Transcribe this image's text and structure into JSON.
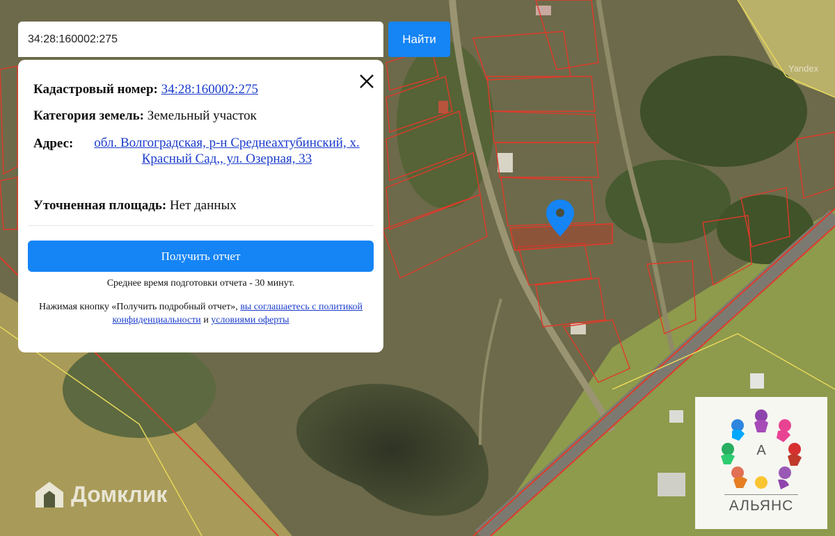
{
  "search": {
    "value": "34:28:160002:275",
    "button_label": "Найти"
  },
  "info": {
    "cadastral_label": "Кадастровый номер:",
    "cadastral_value": "34:28:160002:275",
    "category_label": "Категория земель:",
    "category_value": "Земельный участок",
    "address_label": "Адрес:",
    "address_value": "обл. Волгоградская, р-н Среднеахтубинский, х. Красный Сад,, ул. Озерная, 33",
    "area_label": "Уточненная площадь:",
    "area_value": "Нет данных"
  },
  "report": {
    "button_label": "Получить отчет",
    "avg_time_text": "Среднее время подготовки отчета - 30 минут.",
    "agree_prefix": "Нажимая кнопку «Получить подробный отчет»,",
    "agree_link1": "вы соглашаетесь с политикой конфиденциальности",
    "agree_and": "и",
    "agree_link2": "условиями оферты"
  },
  "watermarks": {
    "domclick": "Домклик",
    "yandex": "Yandex",
    "alliance_letter": "A",
    "alliance_name": "АЛЬЯНС"
  },
  "colors": {
    "accent": "#1584f5",
    "link": "#1a3ccc",
    "parcel_outline": "#e03a2a",
    "pin": "#1584f5"
  }
}
